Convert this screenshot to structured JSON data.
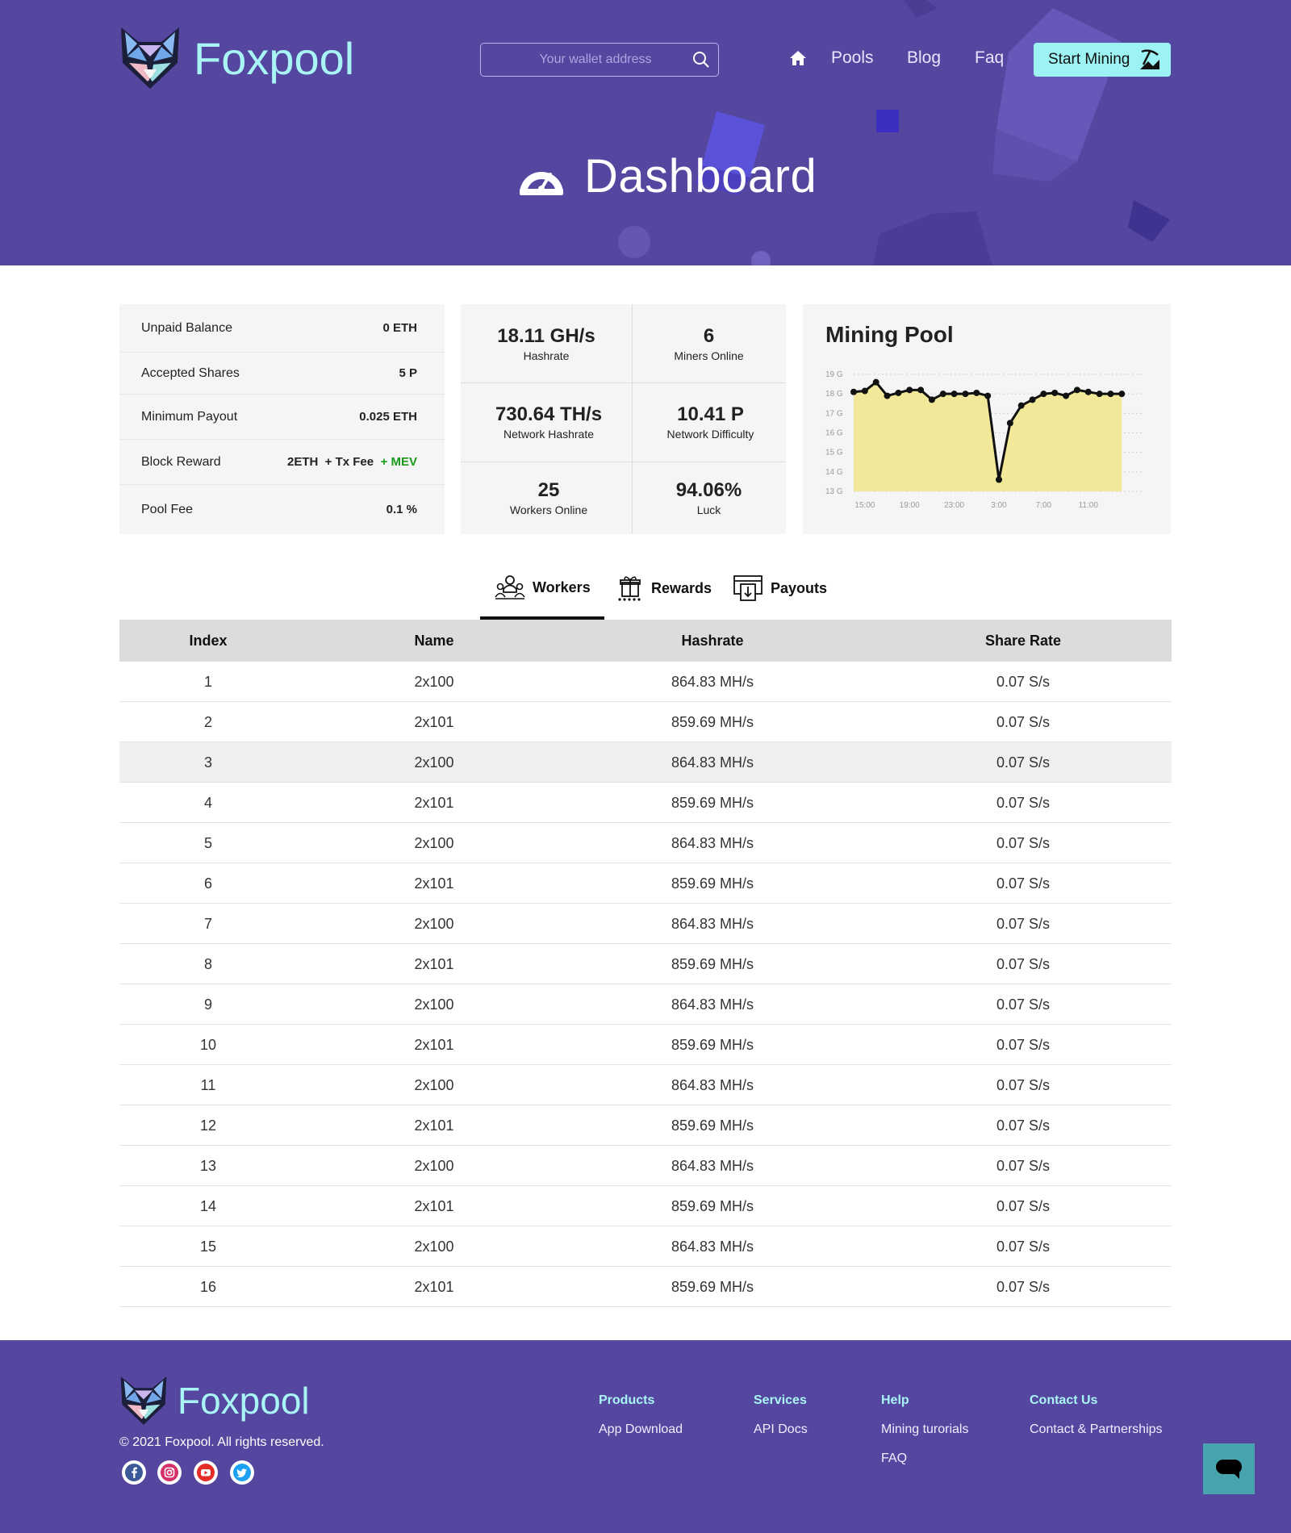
{
  "header": {
    "brand": "Foxpool",
    "search_placeholder": "Your wallet address",
    "nav": [
      "Pools",
      "Blog",
      "Faq"
    ],
    "start_mining_label": "Start Mining",
    "page_title": "Dashboard"
  },
  "account_stats": [
    {
      "label": "Unpaid Balance",
      "value": "0 ETH"
    },
    {
      "label": "Accepted Shares",
      "value": "5 P"
    },
    {
      "label": "Minimum Payout",
      "value": "0.025 ETH"
    },
    {
      "label": "Block Reward",
      "value": "2ETH  + Tx Fee",
      "extra": "+ MEV"
    },
    {
      "label": "Pool Fee",
      "value": "0.1 %"
    }
  ],
  "pool_stats": [
    {
      "value": "18.11 GH/s",
      "label": "Hashrate"
    },
    {
      "value": "6",
      "label": "Miners Online"
    },
    {
      "value": "730.64 TH/s",
      "label": "Network Hashrate"
    },
    {
      "value": "10.41 P",
      "label": "Network Difficulty"
    },
    {
      "value": "25",
      "label": "Workers Online"
    },
    {
      "value": "94.06%",
      "label": "Luck"
    }
  ],
  "chart_data": {
    "type": "area",
    "title": "Mining Pool",
    "xlabel": "",
    "ylabel": "",
    "y_tick_labels": [
      "19 G",
      "18 G",
      "17 G",
      "16 G",
      "15 G",
      "14 G",
      "13 G"
    ],
    "x_tick_labels": [
      "15:00",
      "19:00",
      "23:00",
      "3:00",
      "7:00",
      "11:00"
    ],
    "ylim": [
      13,
      19
    ],
    "x": [
      14,
      15,
      16,
      17,
      18,
      19,
      20,
      21,
      22,
      23,
      24,
      25,
      26,
      27,
      28,
      29,
      30,
      31,
      32,
      33,
      34,
      35,
      36,
      37,
      38
    ],
    "values": [
      18.1,
      18.15,
      18.6,
      17.9,
      18.05,
      18.2,
      18.2,
      17.7,
      18.0,
      18.0,
      18.0,
      18.05,
      17.9,
      13.6,
      16.5,
      17.4,
      17.7,
      18.0,
      18.05,
      17.9,
      18.2,
      18.1,
      18.0,
      18.0,
      18.0
    ],
    "fill_color": "#f1e89a",
    "line_color": "#111111",
    "grid": true
  },
  "tabs": [
    {
      "label": "Workers",
      "active": true
    },
    {
      "label": "Rewards",
      "active": false
    },
    {
      "label": "Payouts",
      "active": false
    }
  ],
  "table": {
    "columns": [
      "Index",
      "Name",
      "Hashrate",
      "Share Rate"
    ],
    "rows": [
      [
        "1",
        "2x100",
        "864.83 MH/s",
        "0.07 S/s"
      ],
      [
        "2",
        "2x101",
        "859.69 MH/s",
        "0.07 S/s"
      ],
      [
        "3",
        "2x100",
        "864.83 MH/s",
        "0.07 S/s"
      ],
      [
        "4",
        "2x101",
        "859.69 MH/s",
        "0.07 S/s"
      ],
      [
        "5",
        "2x100",
        "864.83 MH/s",
        "0.07 S/s"
      ],
      [
        "6",
        "2x101",
        "859.69 MH/s",
        "0.07 S/s"
      ],
      [
        "7",
        "2x100",
        "864.83 MH/s",
        "0.07 S/s"
      ],
      [
        "8",
        "2x101",
        "859.69 MH/s",
        "0.07 S/s"
      ],
      [
        "9",
        "2x100",
        "864.83 MH/s",
        "0.07 S/s"
      ],
      [
        "10",
        "2x101",
        "859.69 MH/s",
        "0.07 S/s"
      ],
      [
        "11",
        "2x100",
        "864.83 MH/s",
        "0.07 S/s"
      ],
      [
        "12",
        "2x101",
        "859.69 MH/s",
        "0.07 S/s"
      ],
      [
        "13",
        "2x100",
        "864.83 MH/s",
        "0.07 S/s"
      ],
      [
        "14",
        "2x101",
        "859.69 MH/s",
        "0.07 S/s"
      ],
      [
        "15",
        "2x100",
        "864.83 MH/s",
        "0.07 S/s"
      ],
      [
        "16",
        "2x101",
        "859.69 MH/s",
        "0.07 S/s"
      ]
    ]
  },
  "footer": {
    "brand": "Foxpool",
    "copyright": "© 2021 Foxpool. All rights reserved.",
    "social_icons": [
      "facebook-icon",
      "instagram-icon",
      "youtube-icon",
      "twitter-icon"
    ],
    "columns": [
      {
        "heading": "Products",
        "links": [
          "App Download"
        ]
      },
      {
        "heading": "Services",
        "links": [
          "API Docs"
        ]
      },
      {
        "heading": "Help",
        "links": [
          "Mining turorials",
          "FAQ"
        ]
      },
      {
        "heading": "Contact Us",
        "links": [
          "Contact & Partnerships"
        ]
      }
    ]
  },
  "colors": {
    "brand_purple": "#5546a0",
    "accent_cyan": "#9df3f3",
    "mev_green": "#1a9a1a",
    "chat_teal": "#47a4ae"
  }
}
